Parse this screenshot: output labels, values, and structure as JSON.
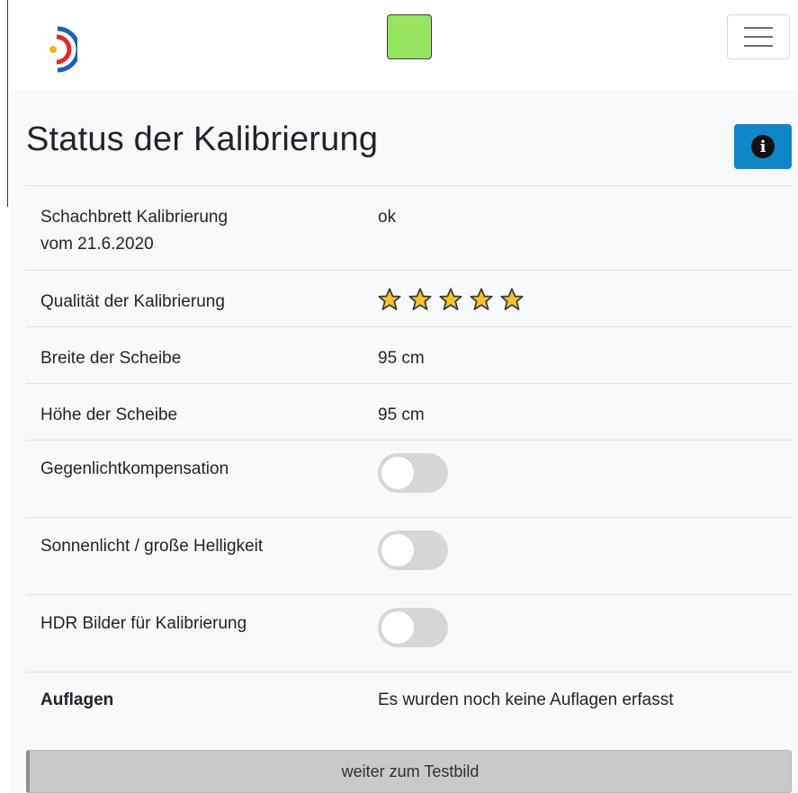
{
  "header": {
    "logo_icon": "target-logo-icon",
    "status_color": "#96e35f",
    "menu_icon": "hamburger-menu-icon"
  },
  "page": {
    "title": "Status der Kalibrierung",
    "info_icon": "info-circle-icon",
    "info_button_color": "#0f86c8"
  },
  "calibration": {
    "chessboard_label": "Schachbrett Kalibrierung",
    "chessboard_date": "vom 21.6.2020",
    "chessboard_value": "ok",
    "quality_label": "Qualität der Kalibrierung",
    "quality_stars": 5,
    "quality_max": 5,
    "width_label": "Breite der Scheibe",
    "width_value": "95 cm",
    "height_label": "Höhe der Scheibe",
    "height_value": "95 cm"
  },
  "settings": {
    "backlight_label": "Gegenlichtkompensation",
    "backlight_on": false,
    "sunlight_label": "Sonnenlicht / große Helligkeit",
    "sunlight_on": false,
    "hdr_label": "HDR Bilder für Kalibrierung",
    "hdr_on": false
  },
  "targets": {
    "label": "Auflagen",
    "value": "Es wurden noch keine Auflagen erfasst"
  },
  "footer": {
    "next_button": "weiter zum Testbild"
  }
}
